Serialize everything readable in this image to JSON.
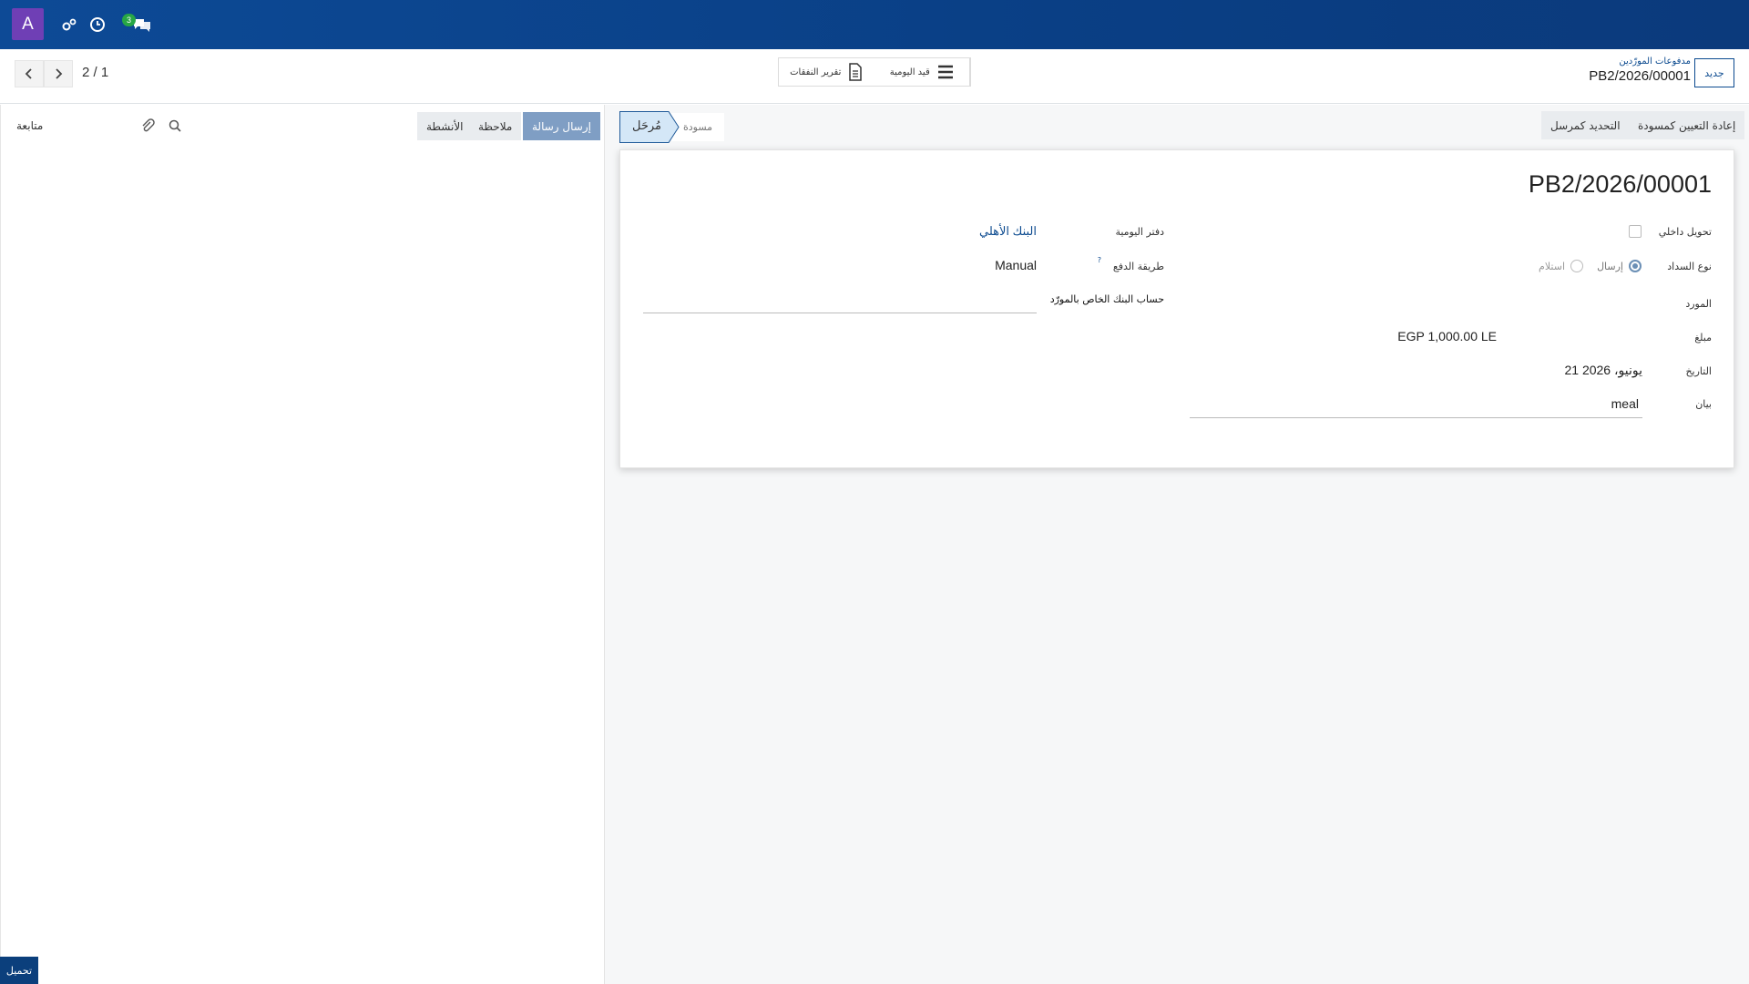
{
  "navbar": {
    "avatar_letter": "A",
    "badge_count": "3",
    "icons": [
      "settings-icon",
      "clock-icon",
      "chat-icon"
    ]
  },
  "control_panel": {
    "pager": "2 / 1",
    "stat_buttons": {
      "expense_report": "تقرير النفقات",
      "journal_entry": "قيد اليومية"
    },
    "breadcrumb": {
      "parent": "مدفوعات المورّدين",
      "current": "PB2/2026/00001"
    },
    "new_button": "جديد"
  },
  "chatter": {
    "send_message": "إرسال رسالة",
    "log_note": "ملاحظة",
    "activities": "الأنشطة",
    "follow": "متابعة"
  },
  "statusbar": {
    "reset_to_draft": "إعادة التعيين كمسودة",
    "mark_as_sent": "التحديد كمرسل",
    "stage_draft": "مسودة",
    "stage_posted": "مُرحَل"
  },
  "form": {
    "title": "PB2/2026/00001",
    "internal_transfer_label": "تحويل داخلي",
    "payment_type_label": "نوع السداد",
    "payment_type_send": "إرسال",
    "payment_type_receive": "استلام",
    "vendor_label": "المورد",
    "amount_label": "مبلغ",
    "amount_value": "EGP 1,000.00 LE",
    "date_label": "التاريخ",
    "date_value": "21 يونيو، 2026",
    "memo_label": "بيان",
    "memo_value": "meal",
    "journal_label": "دفتر اليومية",
    "journal_value": "البنك الأهلي",
    "payment_method_label": "طريقة الدفع",
    "payment_method_help": "?",
    "payment_method_value": "Manual",
    "vendor_bank_label": "حساب البنك الخاص بالمورّد"
  },
  "upload_button": "تحميل"
}
